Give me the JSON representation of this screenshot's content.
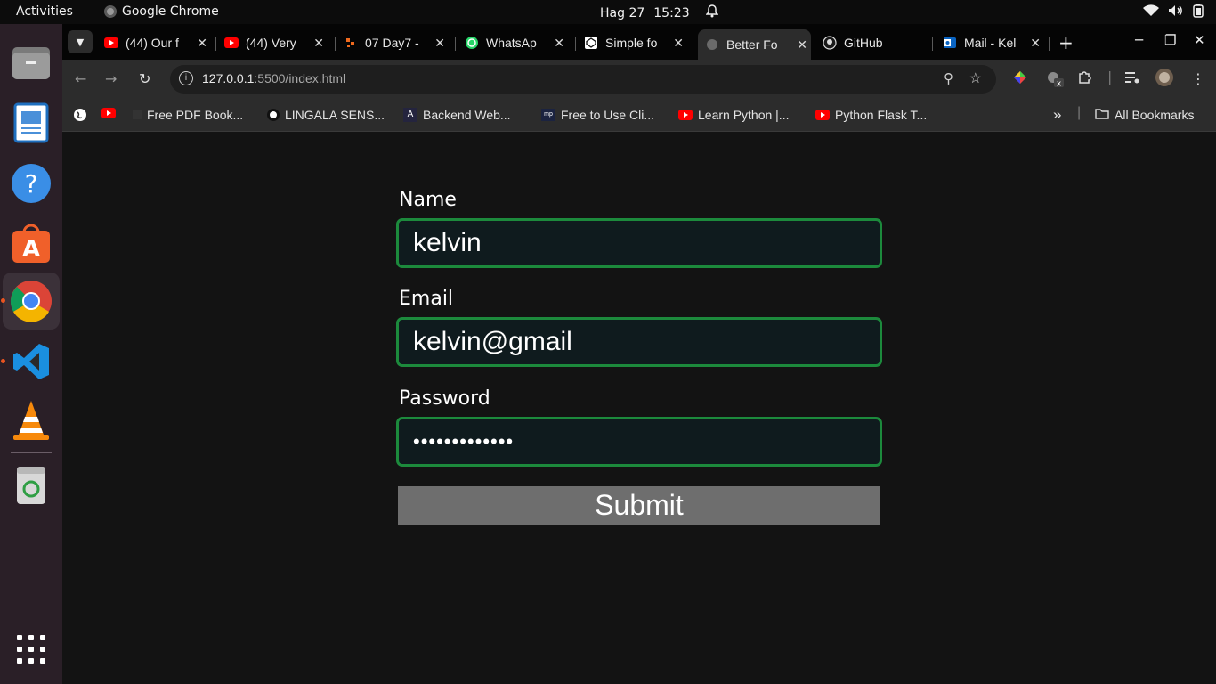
{
  "topbar": {
    "activities": "Activities",
    "app_name": "Google Chrome",
    "date": "Hag 27",
    "time": "15:23"
  },
  "dock": {
    "items": [
      "files-icon",
      "writer-icon",
      "help-icon",
      "app-center-icon",
      "chrome-icon",
      "vscode-icon",
      "vlc-icon",
      "trash-icon",
      "app-grid-icon"
    ],
    "accent": "#e95420"
  },
  "tabs": [
    {
      "title": "(44) Our f",
      "icon": "youtube-icon"
    },
    {
      "title": "(44) Very",
      "icon": "youtube-icon"
    },
    {
      "title": "07 Day7 -",
      "icon": "day7-icon"
    },
    {
      "title": "WhatsAp",
      "icon": "whatsapp-icon"
    },
    {
      "title": "Simple fo",
      "icon": "codepen-icon"
    },
    {
      "title": "Better Fo",
      "icon": "globe-icon",
      "active": true
    },
    {
      "title": "GitHub",
      "icon": "github-icon"
    },
    {
      "title": "Mail - Kel",
      "icon": "outlook-icon"
    }
  ],
  "omnibox": {
    "host": "127.0.0.1",
    "path": ":5500/index.html"
  },
  "bookmarks": [
    {
      "label": "Free PDF Book..."
    },
    {
      "label": "LINGALA SENS..."
    },
    {
      "label": "Backend Web..."
    },
    {
      "label": "Free to Use Cli..."
    },
    {
      "label": "Learn Python |..."
    },
    {
      "label": "Python Flask T..."
    }
  ],
  "all_bookmarks": "All Bookmarks",
  "form": {
    "name_label": "Name",
    "name_value": "kelvin",
    "email_label": "Email",
    "email_value": "kelvin@gmail",
    "password_label": "Password",
    "password_value": "•••••••••••••",
    "submit_label": "Submit",
    "border_color": "#1c8a3c"
  }
}
